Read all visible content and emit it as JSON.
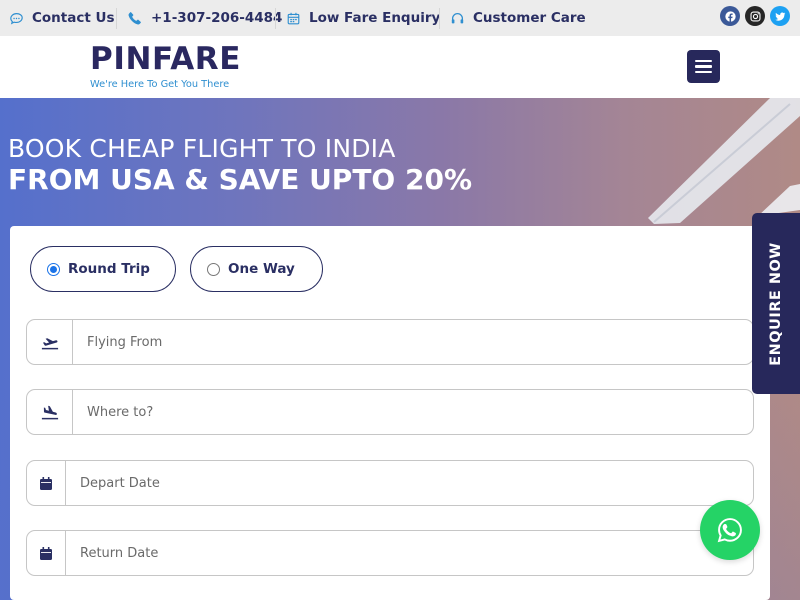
{
  "topbar": {
    "contact_label": "Contact Us",
    "phone_label": "+1-307-206-4484",
    "enquiry_label": "Low Fare Enquiry",
    "care_label": "Customer Care",
    "social_icons": [
      "facebook-icon",
      "instagram-icon",
      "twitter-icon"
    ]
  },
  "header": {
    "logo": "PINFARE",
    "tagline": "We're Here To Get You There",
    "menu_icon": "hamburger-menu-icon"
  },
  "hero": {
    "line1": "BOOK CHEAP FLIGHT TO INDIA",
    "line2": "FROM USA & SAVE UPTO 20%"
  },
  "form": {
    "trip_types": [
      {
        "label": "Round Trip",
        "selected": true
      },
      {
        "label": "One Way",
        "selected": false
      }
    ],
    "from_placeholder": "Flying From",
    "to_placeholder": "Where to?",
    "depart_placeholder": "Depart Date",
    "return_placeholder": "Return Date"
  },
  "side_tab": {
    "label": "ENQUIRE NOW"
  },
  "colors": {
    "brand": "#27285b",
    "accent": "#2f8fd0",
    "whatsapp": "#25d366"
  }
}
